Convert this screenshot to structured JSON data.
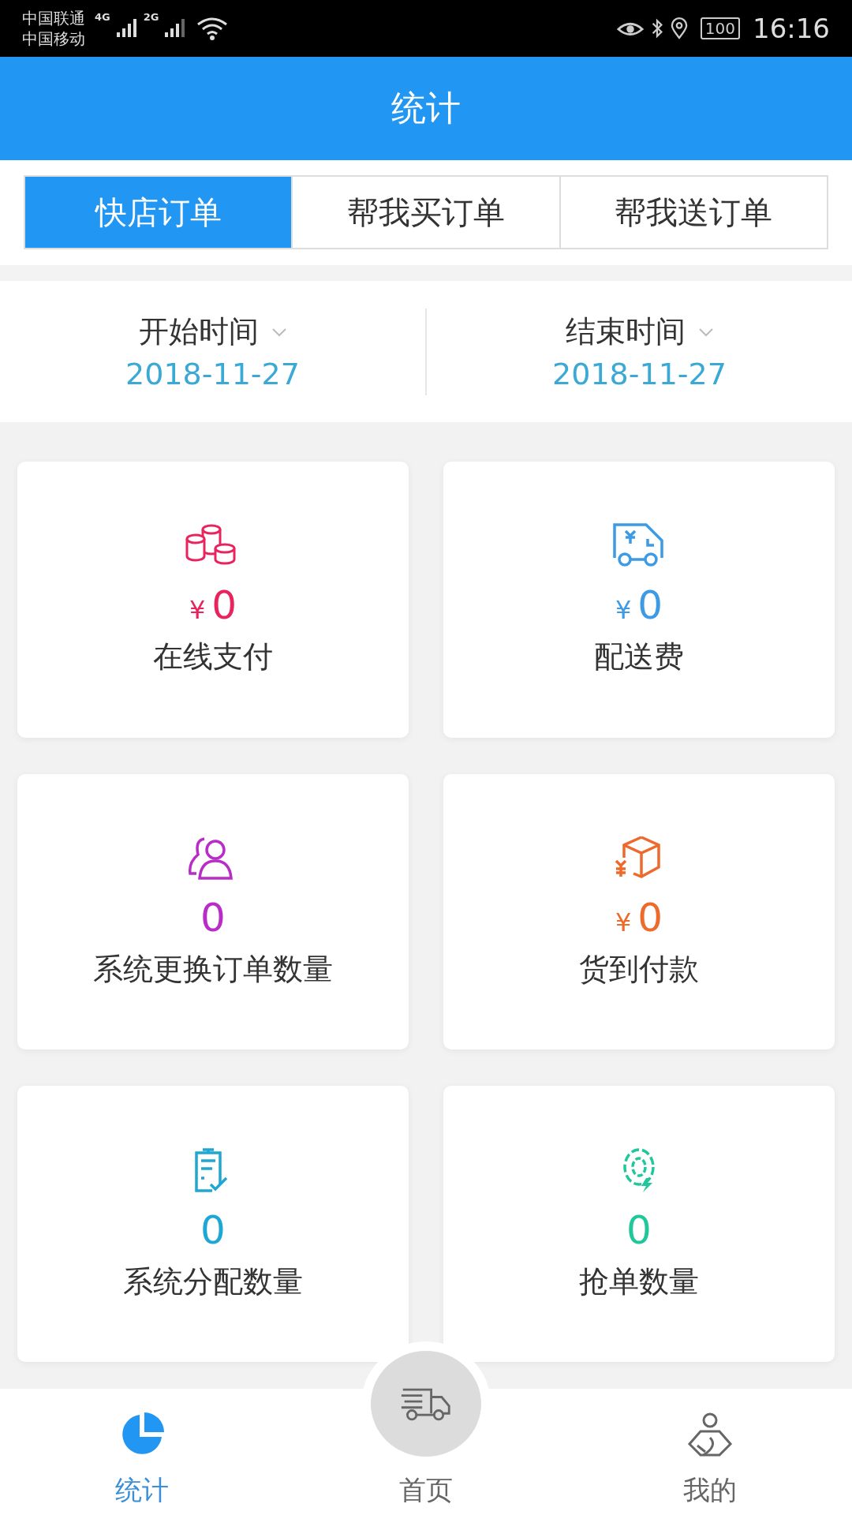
{
  "status_bar": {
    "carriers": [
      "中国联通",
      "中国移动"
    ],
    "networks": [
      "4G",
      "2G"
    ],
    "battery": "100",
    "time": "16:16"
  },
  "header": {
    "title": "统计"
  },
  "tabs": [
    {
      "label": "快店订单",
      "selected": true
    },
    {
      "label": "帮我买订单",
      "selected": false
    },
    {
      "label": "帮我送订单",
      "selected": false
    }
  ],
  "date_range": [
    {
      "label": "开始时间",
      "value": "2018-11-27"
    },
    {
      "label": "结束时间",
      "value": "2018-11-27"
    }
  ],
  "cards": [
    {
      "currency": "¥",
      "value": "0",
      "label": "在线支付",
      "color": "#e8245e"
    },
    {
      "currency": "¥",
      "value": "0",
      "label": "配送费",
      "color": "#3d9be6"
    },
    {
      "value": "0",
      "label": "系统更换订单数量",
      "color": "#b82dc8"
    },
    {
      "currency": "¥",
      "value": "0",
      "label": "货到付款",
      "color": "#ee6a2c"
    },
    {
      "value": "0",
      "label": "系统分配数量",
      "color": "#1fa7d3"
    },
    {
      "value": "0",
      "label": "抢单数量",
      "color": "#1fc79a"
    }
  ],
  "bottom_nav": [
    {
      "label": "统计",
      "selected": true,
      "kind": "side"
    },
    {
      "label": "首页",
      "selected": false,
      "kind": "center"
    },
    {
      "label": "我的",
      "selected": false,
      "kind": "side"
    }
  ]
}
